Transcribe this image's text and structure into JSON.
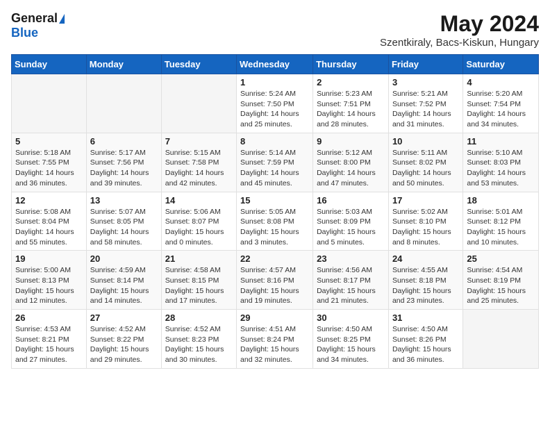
{
  "app": {
    "logo_general": "General",
    "logo_blue": "Blue",
    "title": "May 2024",
    "subtitle": "Szentkiraly, Bacs-Kiskun, Hungary"
  },
  "calendar": {
    "headers": [
      "Sunday",
      "Monday",
      "Tuesday",
      "Wednesday",
      "Thursday",
      "Friday",
      "Saturday"
    ],
    "weeks": [
      [
        {
          "day": "",
          "info": ""
        },
        {
          "day": "",
          "info": ""
        },
        {
          "day": "",
          "info": ""
        },
        {
          "day": "1",
          "info": "Sunrise: 5:24 AM\nSunset: 7:50 PM\nDaylight: 14 hours\nand 25 minutes."
        },
        {
          "day": "2",
          "info": "Sunrise: 5:23 AM\nSunset: 7:51 PM\nDaylight: 14 hours\nand 28 minutes."
        },
        {
          "day": "3",
          "info": "Sunrise: 5:21 AM\nSunset: 7:52 PM\nDaylight: 14 hours\nand 31 minutes."
        },
        {
          "day": "4",
          "info": "Sunrise: 5:20 AM\nSunset: 7:54 PM\nDaylight: 14 hours\nand 34 minutes."
        }
      ],
      [
        {
          "day": "5",
          "info": "Sunrise: 5:18 AM\nSunset: 7:55 PM\nDaylight: 14 hours\nand 36 minutes."
        },
        {
          "day": "6",
          "info": "Sunrise: 5:17 AM\nSunset: 7:56 PM\nDaylight: 14 hours\nand 39 minutes."
        },
        {
          "day": "7",
          "info": "Sunrise: 5:15 AM\nSunset: 7:58 PM\nDaylight: 14 hours\nand 42 minutes."
        },
        {
          "day": "8",
          "info": "Sunrise: 5:14 AM\nSunset: 7:59 PM\nDaylight: 14 hours\nand 45 minutes."
        },
        {
          "day": "9",
          "info": "Sunrise: 5:12 AM\nSunset: 8:00 PM\nDaylight: 14 hours\nand 47 minutes."
        },
        {
          "day": "10",
          "info": "Sunrise: 5:11 AM\nSunset: 8:02 PM\nDaylight: 14 hours\nand 50 minutes."
        },
        {
          "day": "11",
          "info": "Sunrise: 5:10 AM\nSunset: 8:03 PM\nDaylight: 14 hours\nand 53 minutes."
        }
      ],
      [
        {
          "day": "12",
          "info": "Sunrise: 5:08 AM\nSunset: 8:04 PM\nDaylight: 14 hours\nand 55 minutes."
        },
        {
          "day": "13",
          "info": "Sunrise: 5:07 AM\nSunset: 8:05 PM\nDaylight: 14 hours\nand 58 minutes."
        },
        {
          "day": "14",
          "info": "Sunrise: 5:06 AM\nSunset: 8:07 PM\nDaylight: 15 hours\nand 0 minutes."
        },
        {
          "day": "15",
          "info": "Sunrise: 5:05 AM\nSunset: 8:08 PM\nDaylight: 15 hours\nand 3 minutes."
        },
        {
          "day": "16",
          "info": "Sunrise: 5:03 AM\nSunset: 8:09 PM\nDaylight: 15 hours\nand 5 minutes."
        },
        {
          "day": "17",
          "info": "Sunrise: 5:02 AM\nSunset: 8:10 PM\nDaylight: 15 hours\nand 8 minutes."
        },
        {
          "day": "18",
          "info": "Sunrise: 5:01 AM\nSunset: 8:12 PM\nDaylight: 15 hours\nand 10 minutes."
        }
      ],
      [
        {
          "day": "19",
          "info": "Sunrise: 5:00 AM\nSunset: 8:13 PM\nDaylight: 15 hours\nand 12 minutes."
        },
        {
          "day": "20",
          "info": "Sunrise: 4:59 AM\nSunset: 8:14 PM\nDaylight: 15 hours\nand 14 minutes."
        },
        {
          "day": "21",
          "info": "Sunrise: 4:58 AM\nSunset: 8:15 PM\nDaylight: 15 hours\nand 17 minutes."
        },
        {
          "day": "22",
          "info": "Sunrise: 4:57 AM\nSunset: 8:16 PM\nDaylight: 15 hours\nand 19 minutes."
        },
        {
          "day": "23",
          "info": "Sunrise: 4:56 AM\nSunset: 8:17 PM\nDaylight: 15 hours\nand 21 minutes."
        },
        {
          "day": "24",
          "info": "Sunrise: 4:55 AM\nSunset: 8:18 PM\nDaylight: 15 hours\nand 23 minutes."
        },
        {
          "day": "25",
          "info": "Sunrise: 4:54 AM\nSunset: 8:19 PM\nDaylight: 15 hours\nand 25 minutes."
        }
      ],
      [
        {
          "day": "26",
          "info": "Sunrise: 4:53 AM\nSunset: 8:21 PM\nDaylight: 15 hours\nand 27 minutes."
        },
        {
          "day": "27",
          "info": "Sunrise: 4:52 AM\nSunset: 8:22 PM\nDaylight: 15 hours\nand 29 minutes."
        },
        {
          "day": "28",
          "info": "Sunrise: 4:52 AM\nSunset: 8:23 PM\nDaylight: 15 hours\nand 30 minutes."
        },
        {
          "day": "29",
          "info": "Sunrise: 4:51 AM\nSunset: 8:24 PM\nDaylight: 15 hours\nand 32 minutes."
        },
        {
          "day": "30",
          "info": "Sunrise: 4:50 AM\nSunset: 8:25 PM\nDaylight: 15 hours\nand 34 minutes."
        },
        {
          "day": "31",
          "info": "Sunrise: 4:50 AM\nSunset: 8:26 PM\nDaylight: 15 hours\nand 36 minutes."
        },
        {
          "day": "",
          "info": ""
        }
      ]
    ]
  }
}
